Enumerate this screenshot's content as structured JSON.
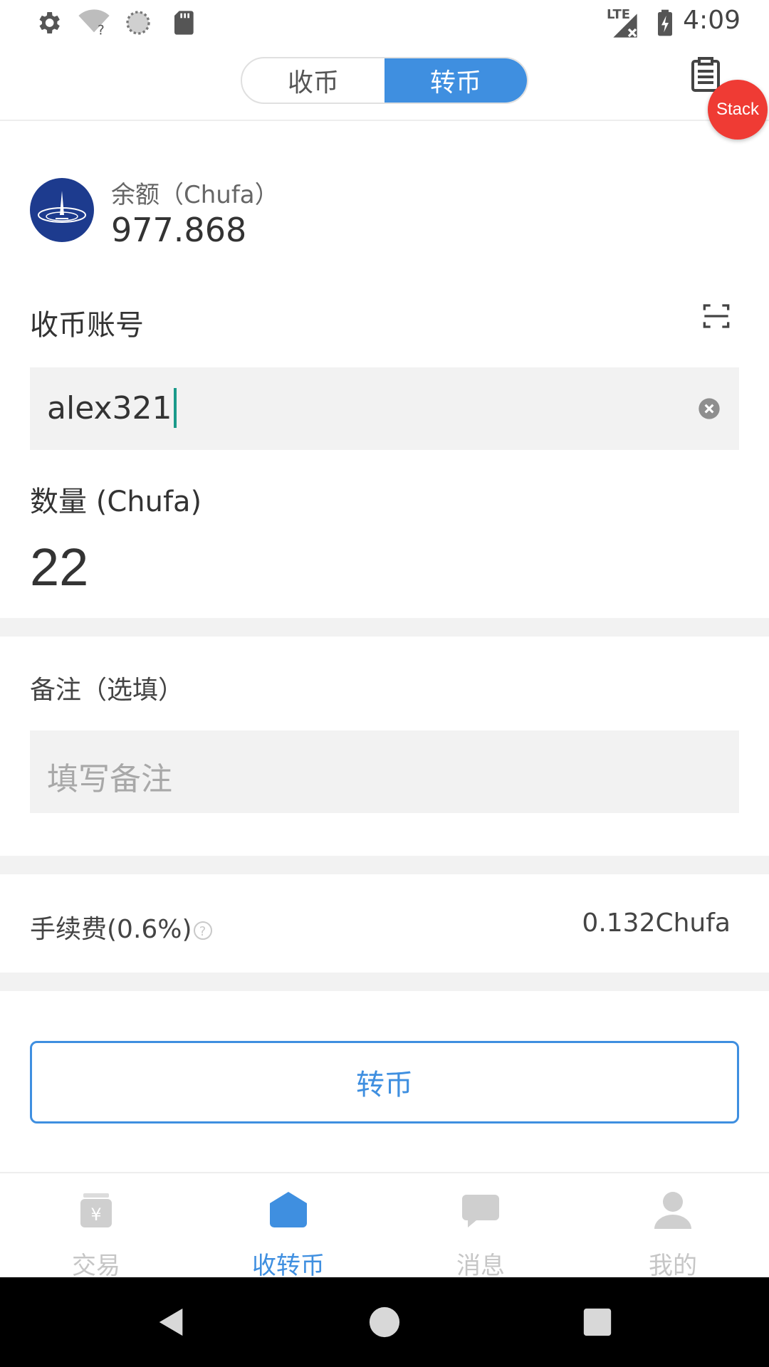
{
  "status_bar": {
    "time": "4:09",
    "network": "LTE",
    "icons": [
      "settings-icon",
      "wifi-unknown-icon",
      "sync-icon",
      "sd-card-icon",
      "signal-icon",
      "battery-charging-icon"
    ]
  },
  "header": {
    "tabs": [
      {
        "label": "收币",
        "active": false
      },
      {
        "label": "转币",
        "active": true
      }
    ],
    "right_icon": "clipboard-icon"
  },
  "stack_badge": "Stack",
  "balance": {
    "label": "余额（Chufa）",
    "value": "977.868"
  },
  "account": {
    "label": "收币账号",
    "value": "alex321",
    "scan_icon": "scan-icon",
    "clear_icon": "clear-icon"
  },
  "amount": {
    "label": "数量 (Chufa)",
    "value": "22"
  },
  "memo": {
    "label": "备注（选填）",
    "placeholder": "填写备注"
  },
  "fee": {
    "label": "手续费(0.6%)",
    "help_glyph": "?",
    "value": "0.132Chufa"
  },
  "submit_label": "转币",
  "bottom_nav": [
    {
      "label": "交易",
      "icon": "trade-icon",
      "active": false
    },
    {
      "label": "收转币",
      "icon": "wallet-icon",
      "active": true
    },
    {
      "label": "消息",
      "icon": "message-icon",
      "active": false
    },
    {
      "label": "我的",
      "icon": "profile-icon",
      "active": false
    }
  ],
  "colors": {
    "accent": "#3f8fe0",
    "badge": "#ef3b34",
    "field_bg": "#f2f2f2",
    "inactive": "#c6c6c6"
  }
}
